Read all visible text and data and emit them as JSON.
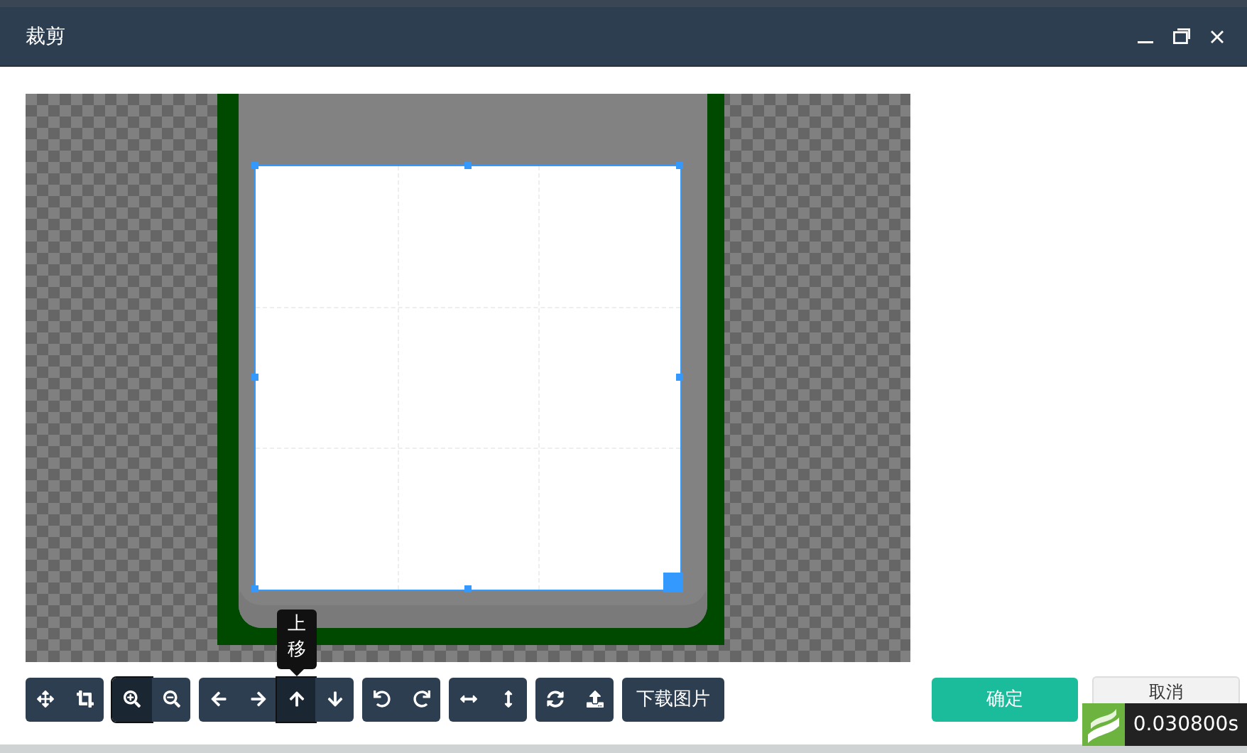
{
  "window": {
    "title": "裁剪"
  },
  "toolbar": {
    "groups": [
      {
        "buttons": [
          {
            "active": false
          },
          {
            "active": false
          }
        ]
      },
      {
        "buttons": [
          {
            "active": true
          },
          {
            "active": false
          }
        ]
      },
      {
        "buttons": [
          {
            "active": false
          },
          {
            "active": false
          },
          {
            "active": true,
            "tooltip": "上移"
          },
          {
            "active": false
          }
        ]
      },
      {
        "buttons": [
          {
            "active": false
          },
          {
            "active": false
          }
        ]
      },
      {
        "buttons": [
          {
            "active": false
          },
          {
            "active": false
          }
        ]
      },
      {
        "buttons": [
          {
            "active": false
          },
          {
            "active": false
          }
        ]
      },
      {
        "buttons": [
          {
            "active": false,
            "label": "下载图片"
          }
        ]
      }
    ]
  },
  "actions": {
    "confirm": "确定",
    "cancel": "取消"
  },
  "timer": {
    "value": "0.030800s"
  }
}
